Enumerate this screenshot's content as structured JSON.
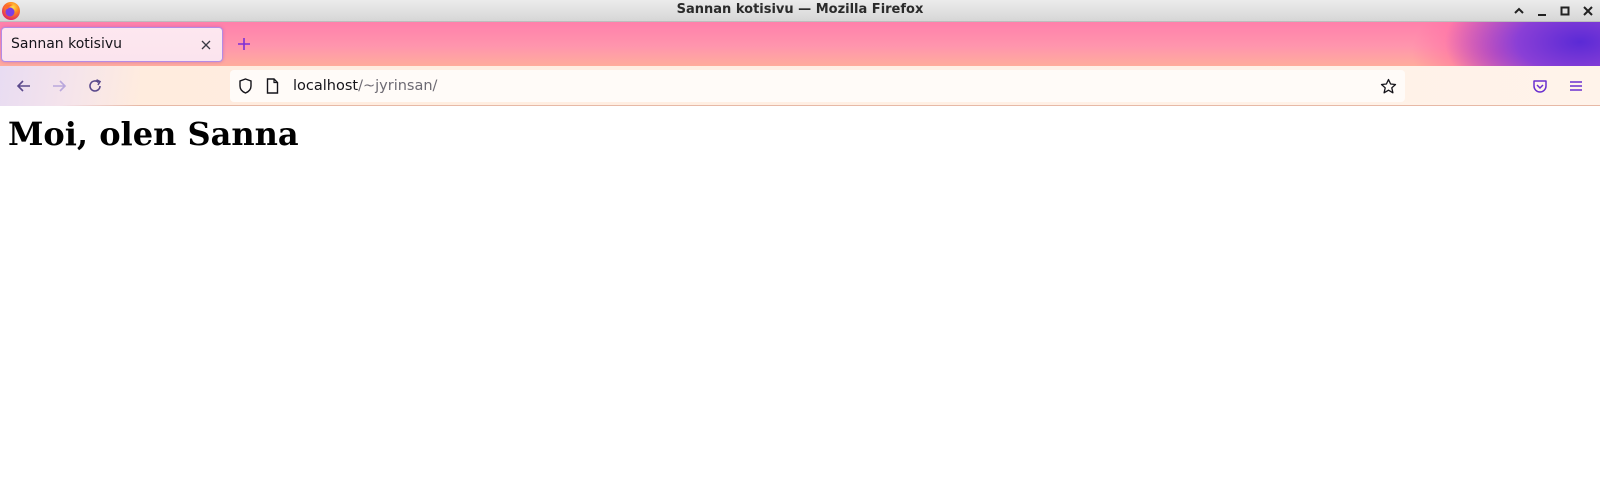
{
  "window": {
    "title": "Sannan kotisivu — Mozilla Firefox",
    "icon": "firefox-icon",
    "controls": [
      "minimize-up-icon",
      "minimize-icon",
      "maximize-icon",
      "close-icon"
    ]
  },
  "tabs": [
    {
      "label": "Sannan kotisivu",
      "active": true,
      "close_icon": "close-icon"
    }
  ],
  "toolbar": {
    "back_icon": "arrow-left-icon",
    "forward_icon": "arrow-right-icon",
    "reload_icon": "reload-icon",
    "new_tab_icon": "plus-icon",
    "pocket_icon": "pocket-icon",
    "menu_icon": "hamburger-menu-icon"
  },
  "urlbar": {
    "host": "localhost",
    "path": "/~jyrinsan/",
    "shield_icon": "shield-icon",
    "page_icon": "page-icon",
    "bookmark_icon": "star-icon"
  },
  "page": {
    "heading": "Moi, olen Sanna"
  },
  "colors": {
    "accent": "#8000d7",
    "tab_border": "#b38ce6",
    "toolbar_bg": "#fdeee4"
  }
}
